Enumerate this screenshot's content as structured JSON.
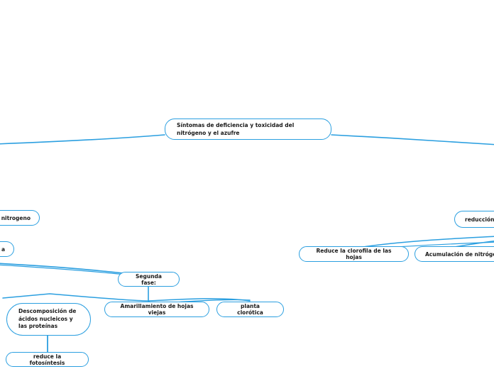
{
  "canvas": {
    "background": "#ffffff",
    "edge_color": "#2b9fe0",
    "node_border_color": "#2b9fe0",
    "node_fill_color": "#ffffff",
    "node_text_color": "#1a1a1a"
  },
  "mindmap": {
    "root": {
      "id": "root",
      "label": "Síntomas de deficiencia y toxicidad del nitrógeno y el azufre"
    },
    "nodes": [
      {
        "id": "n-nitrogeno",
        "label": "nitrogeno",
        "clipped": "left"
      },
      {
        "id": "n-left-fragment",
        "label": "a",
        "clipped": "left"
      },
      {
        "id": "n-reduccion",
        "label": "reducción",
        "clipped": "right"
      },
      {
        "id": "n-reduce-clorofila",
        "label": "Reduce la clorofila de las hojas",
        "clipped": "none"
      },
      {
        "id": "n-acumulacion",
        "label": "Acumulación de nitrógeno",
        "clipped": "right"
      },
      {
        "id": "n-segunda-fase",
        "label": "Segunda fase:",
        "clipped": "none"
      },
      {
        "id": "n-descomposicion",
        "label": "Descomposición de\nácidos nucleicos y\nlas proteínas",
        "clipped": "none"
      },
      {
        "id": "n-amarillamiento",
        "label": "Amarillamiento de hojas viejas",
        "clipped": "none"
      },
      {
        "id": "n-planta-clorotica",
        "label": "planta clorótica",
        "clipped": "none"
      },
      {
        "id": "n-reduce-fotosintesis",
        "label": "reduce la fotosíntesis",
        "clipped": "none"
      }
    ]
  }
}
